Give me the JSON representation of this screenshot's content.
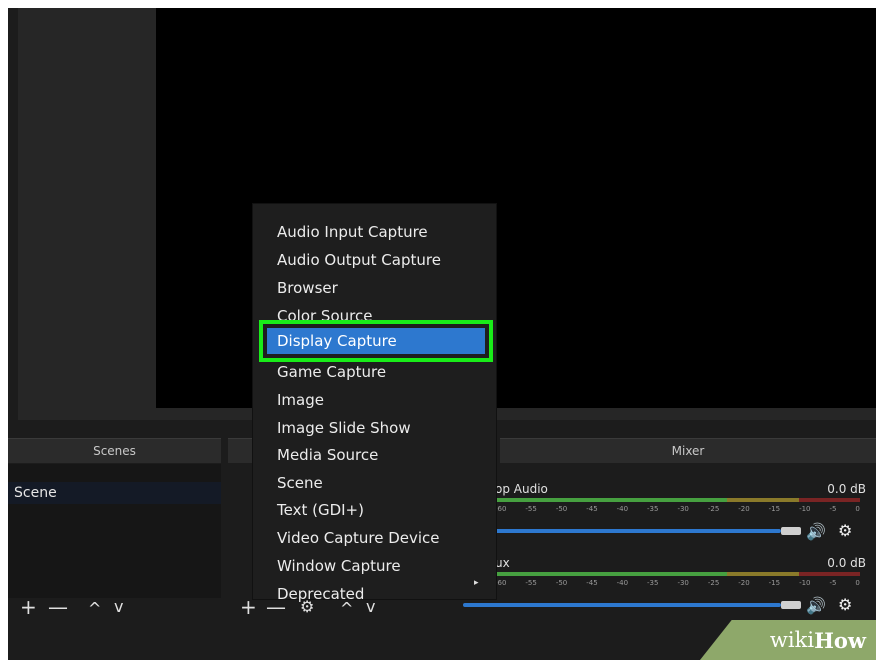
{
  "docks": {
    "scenes_title": "Scenes",
    "mixer_title": "Mixer"
  },
  "scenes": {
    "items": [
      "Scene"
    ]
  },
  "controls": {
    "add": "+",
    "remove": "—",
    "up": "^",
    "down": "v",
    "settings": "⚙"
  },
  "context_menu": {
    "items": [
      "Audio Input Capture",
      "Audio Output Capture",
      "Browser",
      "Color Source",
      "Display Capture",
      "Game Capture",
      "Image",
      "Image Slide Show",
      "Media Source",
      "Scene",
      "Text (GDI+)",
      "Video Capture Device",
      "Window Capture",
      "Deprecated"
    ],
    "highlighted_index": 4,
    "submenu_arrow": "▸"
  },
  "mixer": {
    "channels": [
      {
        "name": "op Audio",
        "db": "0.0 dB"
      },
      {
        "name": "ux",
        "db": "0.0 dB"
      }
    ],
    "ticks": [
      "-60",
      "-55",
      "-50",
      "-45",
      "-40",
      "-35",
      "-30",
      "-25",
      "-20",
      "-15",
      "-10",
      "-5",
      "0"
    ],
    "volume_icon": "🔊"
  },
  "watermark": {
    "wiki": "wiki",
    "how": "How"
  },
  "colors": {
    "highlight": "#2d78cf",
    "annotation_box": "#19ec19",
    "background": "#1c1c1c"
  }
}
